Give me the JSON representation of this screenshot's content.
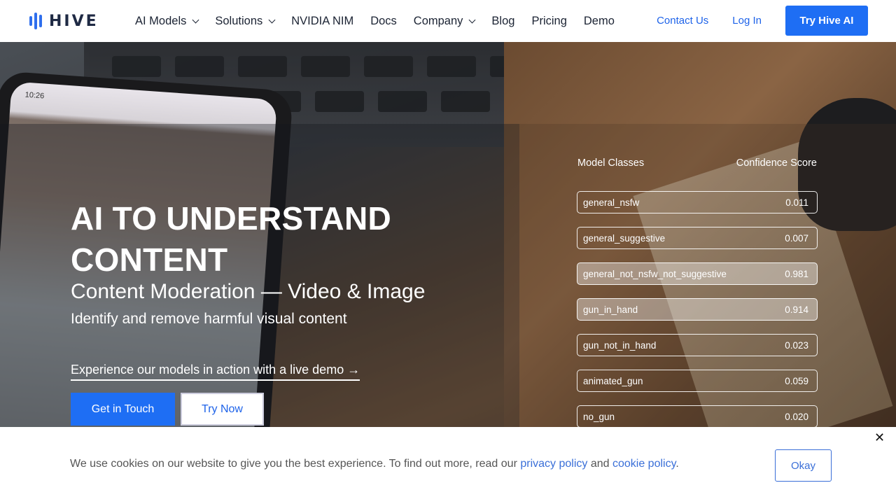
{
  "brand": {
    "name": "HIVE",
    "logo_icon": "hive-bars-logo"
  },
  "nav": {
    "items": [
      {
        "label": "AI Models",
        "dropdown": true
      },
      {
        "label": "Solutions",
        "dropdown": true
      },
      {
        "label": "NVIDIA NIM",
        "dropdown": false
      },
      {
        "label": "Docs",
        "dropdown": false
      },
      {
        "label": "Company",
        "dropdown": true
      },
      {
        "label": "Blog",
        "dropdown": false
      },
      {
        "label": "Pricing",
        "dropdown": false
      },
      {
        "label": "Demo",
        "dropdown": false
      }
    ],
    "contact": "Contact Us",
    "login": "Log In",
    "cta": "Try Hive AI"
  },
  "hero": {
    "phone_time": "10:26",
    "headline": "AI TO UNDERSTAND CONTENT",
    "subhead": "Content Moderation — Video & Image",
    "tagline": "Identify and remove harmful visual content",
    "demo_link": "Experience our models in action with a live demo →",
    "primary_button": "Get in Touch",
    "secondary_button": "Try Now"
  },
  "results": {
    "col_class": "Model Classes",
    "col_score": "Confidence Score",
    "rows": [
      {
        "name": "general_nsfw",
        "score": "0.011",
        "highlight": false
      },
      {
        "name": "general_suggestive",
        "score": "0.007",
        "highlight": false
      },
      {
        "name": "general_not_nsfw_not_suggestive",
        "score": "0.981",
        "highlight": true
      },
      {
        "name": "gun_in_hand",
        "score": "0.914",
        "highlight": true
      },
      {
        "name": "gun_not_in_hand",
        "score": "0.023",
        "highlight": false
      },
      {
        "name": "animated_gun",
        "score": "0.059",
        "highlight": false
      },
      {
        "name": "no_gun",
        "score": "0.020",
        "highlight": false
      }
    ]
  },
  "cookie": {
    "text_before": "We use cookies on our website to give you the best experience. To find out more, read our",
    "privacy_link": "privacy policy",
    "and": "and",
    "cookie_link": "cookie policy",
    "period": ".",
    "close": "✕",
    "ok": "Okay"
  },
  "colors": {
    "accent": "#1e6ef4",
    "link": "#3a6fd8",
    "text_dark": "#1b2333"
  }
}
